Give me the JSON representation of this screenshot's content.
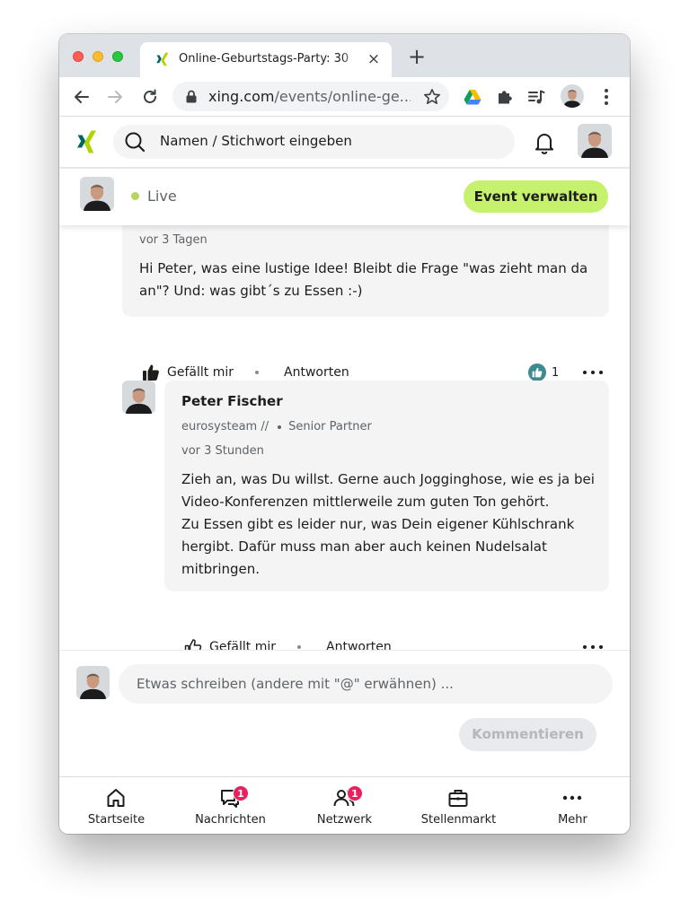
{
  "browser": {
    "tab_title": "Online-Geburtstags-Party: 30",
    "tab_close": "×",
    "new_tab": "+",
    "url_host": "xing.com",
    "url_rest": "/events/online-ge..."
  },
  "header": {
    "search_placeholder": "Namen / Stichwort eingeben"
  },
  "event_bar": {
    "status": "Live",
    "manage_button": "Event verwalten"
  },
  "comments": [
    {
      "time": "vor 3 Tagen",
      "text": "Hi Peter, was eine lustige Idee! Bleibt die Frage \"was zieht man da an\"? Und: was gibt´s zu Essen :-)",
      "like_label": "Gefällt mir",
      "reply_label": "Antworten",
      "like_count": "1"
    }
  ],
  "reply": {
    "author": "Peter Fischer",
    "company": "eurosysteam //",
    "position": "Senior Partner",
    "time": "vor 3 Stunden",
    "text": "Zieh an, was Du willst. Gerne auch Jogginghose, wie es ja bei Video-Konferenzen mittlerweile zum guten Ton gehört.\nZu Essen gibt es leider nur, was Dein eigener Kühlschrank hergibt. Dafür muss man aber auch keinen Nudelsalat mitbringen.",
    "like_label": "Gefällt mir",
    "reply_label": "Antworten"
  },
  "composer": {
    "placeholder": "Etwas schreiben (andere mit \"@\" erwähnen) ...",
    "submit_label": "Kommentieren"
  },
  "bottom_nav": [
    {
      "label": "Startseite",
      "icon": "home-icon",
      "badge": ""
    },
    {
      "label": "Nachrichten",
      "icon": "messages-icon",
      "badge": "1"
    },
    {
      "label": "Netzwerk",
      "icon": "network-icon",
      "badge": "1"
    },
    {
      "label": "Stellenmarkt",
      "icon": "briefcase-icon",
      "badge": ""
    },
    {
      "label": "Mehr",
      "icon": "more-icon",
      "badge": ""
    }
  ],
  "colors": {
    "accent_green": "#c6f16d",
    "live_dot": "#b5d55f",
    "like_badge": "#3e8b8f",
    "notification_badge": "#e91f5e",
    "xing_green": "#b0d400",
    "xing_teal": "#006567"
  }
}
